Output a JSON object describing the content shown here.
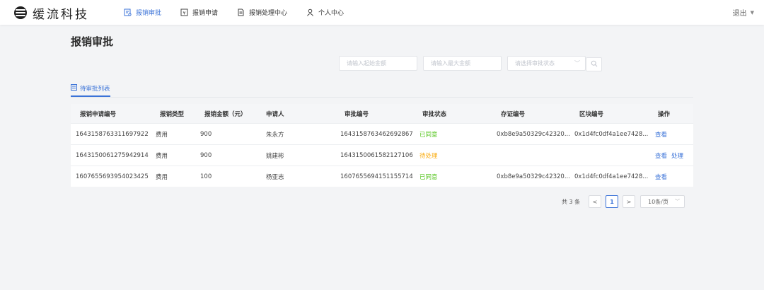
{
  "brand": {
    "name": "缓流科技"
  },
  "nav": [
    {
      "label": "报销审批",
      "icon": "approval-doc-icon",
      "active": true
    },
    {
      "label": "报销申请",
      "icon": "yen-receipt-icon",
      "active": false
    },
    {
      "label": "报销处理中心",
      "icon": "document-icon",
      "active": false
    },
    {
      "label": "个人中心",
      "icon": "user-icon",
      "active": false
    }
  ],
  "header": {
    "logout_label": "退出"
  },
  "page": {
    "title": "报销审批"
  },
  "filters": {
    "min_amount_placeholder": "请输入起始金额",
    "max_amount_placeholder": "请输入最大金额",
    "status_placeholder": "请选择审批状态"
  },
  "tab": {
    "label": "待审批列表"
  },
  "table": {
    "columns": [
      "报销申请编号",
      "报销类型",
      "报销金额（元）",
      "申请人",
      "审批编号",
      "审批状态",
      "存证编号",
      "区块编号",
      "操作"
    ],
    "rows": [
      {
        "id": "1643158763311697922",
        "type": "费用",
        "amount": "900",
        "applicant": "朱永方",
        "approval_no": "1643158763462692867",
        "status": "已同意",
        "status_kind": "ok",
        "evidence_no": "0xb8e9a50329c42320...",
        "block_no": "0x1d4fc0df4a1ee7428...",
        "actions": [
          "查看"
        ]
      },
      {
        "id": "1643150061275942914",
        "type": "费用",
        "amount": "900",
        "applicant": "姚建彬",
        "approval_no": "1643150061582127106",
        "status": "待处理",
        "status_kind": "pending",
        "evidence_no": "",
        "block_no": "",
        "actions": [
          "查看",
          "处理"
        ]
      },
      {
        "id": "1607655693954023425",
        "type": "费用",
        "amount": "100",
        "applicant": "杨亚志",
        "approval_no": "1607655694151155714",
        "status": "已同意",
        "status_kind": "ok",
        "evidence_no": "0xb8e9a50329c42320...",
        "block_no": "0x1d4fc0df4a1ee7428...",
        "actions": [
          "查看"
        ]
      }
    ]
  },
  "pagination": {
    "total_label": "共 3 条",
    "current_page": "1",
    "page_size_label": "10条/页"
  },
  "colors": {
    "accent": "#3b73d8",
    "ok": "#52c41a",
    "pending": "#faad14"
  }
}
